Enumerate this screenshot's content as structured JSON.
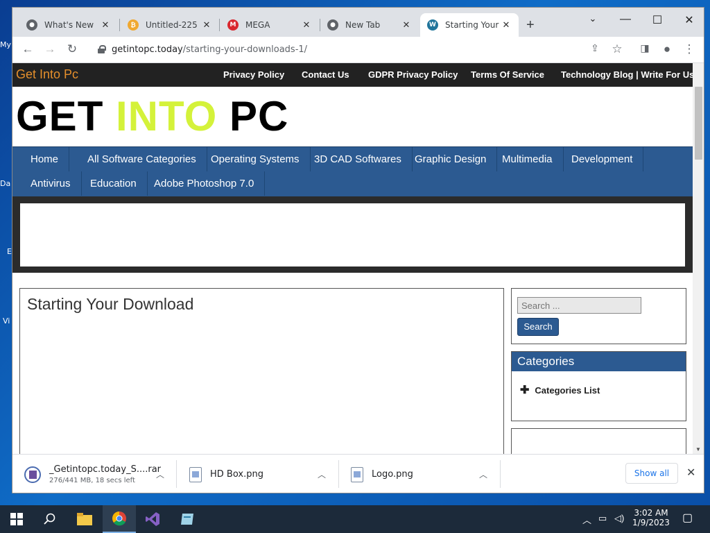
{
  "browser": {
    "tabs": [
      {
        "title": "What's New",
        "favicon": "chrome-icon"
      },
      {
        "title": "Untitled-225",
        "favicon": "bitcoin-icon"
      },
      {
        "title": "MEGA",
        "favicon": "mega-icon"
      },
      {
        "title": "New Tab",
        "favicon": "chrome-icon"
      },
      {
        "title": "Starting Your D",
        "favicon": "wordpress-icon",
        "active": true
      }
    ],
    "new_tab": "+",
    "url_domain": "getintopc.today",
    "url_path": "/starting-your-downloads-1/"
  },
  "site": {
    "name": "Get Into Pc",
    "top_links": [
      "Privacy Policy",
      "Contact Us",
      "GDPR Privacy Policy",
      "Terms Of Service",
      "Technology Blog | Write For Us"
    ],
    "logo_word1": "GET",
    "logo_word2": "INTO",
    "logo_word3": "PC",
    "nav_row1": [
      "Home",
      "All Software Categories",
      "Operating Systems",
      "3D CAD Softwares",
      "Graphic Design",
      "Multimedia",
      "Development"
    ],
    "nav_row2": [
      "Antivirus",
      "Education",
      "Adobe Photoshop 7.0"
    ],
    "content_title": "Starting Your Download",
    "search_placeholder": "Search ...",
    "search_button": "Search",
    "categories_heading": "Categories",
    "categories_item": "Categories List"
  },
  "downloads": {
    "items": [
      {
        "name": "_Getintopc.today_S....rar",
        "status": "276/441 MB, 18 secs left"
      },
      {
        "name": "HD Box.png",
        "status": ""
      },
      {
        "name": "Logo.png",
        "status": ""
      }
    ],
    "show_all": "Show all"
  },
  "taskbar": {
    "time": "3:02 AM",
    "date": "1/9/2023"
  },
  "desktop_labels": [
    "My",
    "Da",
    "E",
    "Vi"
  ],
  "colors": {
    "site_accent": "#e58f2c",
    "logo_highlight": "#d4f23a",
    "nav_blue": "#2c5a91"
  }
}
